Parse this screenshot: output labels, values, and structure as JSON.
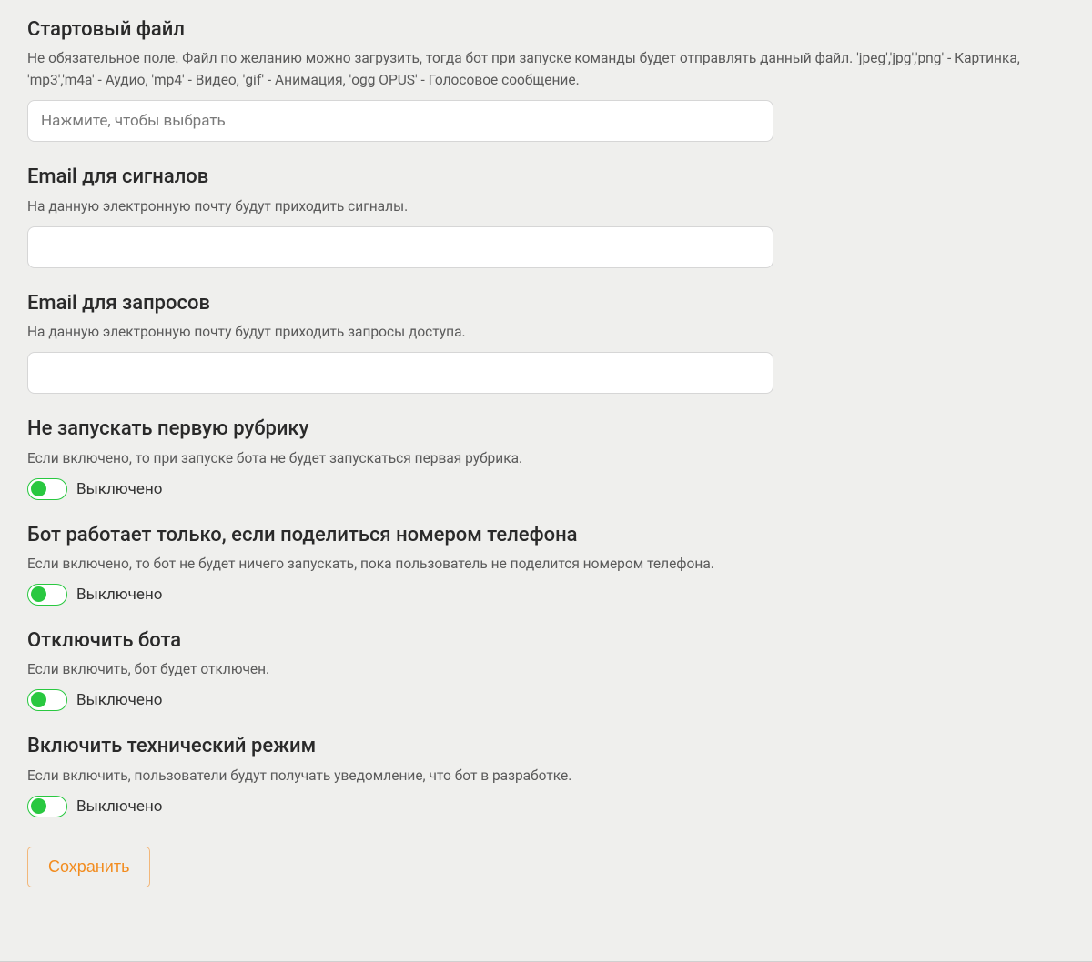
{
  "fields": {
    "start_file": {
      "title": "Стартовый файл",
      "description": "Не обязательное поле. Файл по желанию можно загрузить, тогда бот при запуске команды будет отправлять данный файл. 'jpeg','jpg','png' - Картинка, 'mp3','m4a' - Аудио, 'mp4' - Видео, 'gif' - Анимация, 'ogg OPUS' - Голосовое сообщение.",
      "placeholder": "Нажмите, чтобы выбрать"
    },
    "email_signals": {
      "title": "Email для сигналов",
      "description": "На данную электронную почту будут приходить сигналы.",
      "value": ""
    },
    "email_requests": {
      "title": "Email для запросов",
      "description": "На данную электронную почту будут приходить запросы доступа.",
      "value": ""
    },
    "no_first_rubric": {
      "title": "Не запускать первую рубрику",
      "description": "Если включено, то при запуске бота не будет запускаться первая рубрика.",
      "state_label": "Выключено"
    },
    "require_phone": {
      "title": "Бот работает только, если поделиться номером телефона",
      "description": "Если включено, то бот не будет ничего запускать, пока пользователь не поделится номером телефона.",
      "state_label": "Выключено"
    },
    "disable_bot": {
      "title": "Отключить бота",
      "description": "Если включить, бот будет отключен.",
      "state_label": "Выключено"
    },
    "tech_mode": {
      "title": "Включить технический режим",
      "description": "Если включить, пользователи будут получать уведомление, что бот в разработке.",
      "state_label": "Выключено"
    }
  },
  "actions": {
    "save_label": "Сохранить"
  }
}
